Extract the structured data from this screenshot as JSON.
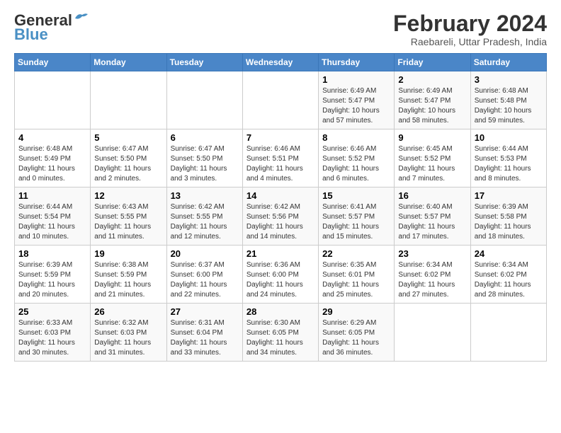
{
  "logo": {
    "line1": "General",
    "line2": "Blue"
  },
  "title": "February 2024",
  "subtitle": "Raebareli, Uttar Pradesh, India",
  "days_of_week": [
    "Sunday",
    "Monday",
    "Tuesday",
    "Wednesday",
    "Thursday",
    "Friday",
    "Saturday"
  ],
  "weeks": [
    [
      {
        "day": "",
        "info": ""
      },
      {
        "day": "",
        "info": ""
      },
      {
        "day": "",
        "info": ""
      },
      {
        "day": "",
        "info": ""
      },
      {
        "day": "1",
        "info": "Sunrise: 6:49 AM\nSunset: 5:47 PM\nDaylight: 10 hours and 57 minutes."
      },
      {
        "day": "2",
        "info": "Sunrise: 6:49 AM\nSunset: 5:47 PM\nDaylight: 10 hours and 58 minutes."
      },
      {
        "day": "3",
        "info": "Sunrise: 6:48 AM\nSunset: 5:48 PM\nDaylight: 10 hours and 59 minutes."
      }
    ],
    [
      {
        "day": "4",
        "info": "Sunrise: 6:48 AM\nSunset: 5:49 PM\nDaylight: 11 hours and 0 minutes."
      },
      {
        "day": "5",
        "info": "Sunrise: 6:47 AM\nSunset: 5:50 PM\nDaylight: 11 hours and 2 minutes."
      },
      {
        "day": "6",
        "info": "Sunrise: 6:47 AM\nSunset: 5:50 PM\nDaylight: 11 hours and 3 minutes."
      },
      {
        "day": "7",
        "info": "Sunrise: 6:46 AM\nSunset: 5:51 PM\nDaylight: 11 hours and 4 minutes."
      },
      {
        "day": "8",
        "info": "Sunrise: 6:46 AM\nSunset: 5:52 PM\nDaylight: 11 hours and 6 minutes."
      },
      {
        "day": "9",
        "info": "Sunrise: 6:45 AM\nSunset: 5:52 PM\nDaylight: 11 hours and 7 minutes."
      },
      {
        "day": "10",
        "info": "Sunrise: 6:44 AM\nSunset: 5:53 PM\nDaylight: 11 hours and 8 minutes."
      }
    ],
    [
      {
        "day": "11",
        "info": "Sunrise: 6:44 AM\nSunset: 5:54 PM\nDaylight: 11 hours and 10 minutes."
      },
      {
        "day": "12",
        "info": "Sunrise: 6:43 AM\nSunset: 5:55 PM\nDaylight: 11 hours and 11 minutes."
      },
      {
        "day": "13",
        "info": "Sunrise: 6:42 AM\nSunset: 5:55 PM\nDaylight: 11 hours and 12 minutes."
      },
      {
        "day": "14",
        "info": "Sunrise: 6:42 AM\nSunset: 5:56 PM\nDaylight: 11 hours and 14 minutes."
      },
      {
        "day": "15",
        "info": "Sunrise: 6:41 AM\nSunset: 5:57 PM\nDaylight: 11 hours and 15 minutes."
      },
      {
        "day": "16",
        "info": "Sunrise: 6:40 AM\nSunset: 5:57 PM\nDaylight: 11 hours and 17 minutes."
      },
      {
        "day": "17",
        "info": "Sunrise: 6:39 AM\nSunset: 5:58 PM\nDaylight: 11 hours and 18 minutes."
      }
    ],
    [
      {
        "day": "18",
        "info": "Sunrise: 6:39 AM\nSunset: 5:59 PM\nDaylight: 11 hours and 20 minutes."
      },
      {
        "day": "19",
        "info": "Sunrise: 6:38 AM\nSunset: 5:59 PM\nDaylight: 11 hours and 21 minutes."
      },
      {
        "day": "20",
        "info": "Sunrise: 6:37 AM\nSunset: 6:00 PM\nDaylight: 11 hours and 22 minutes."
      },
      {
        "day": "21",
        "info": "Sunrise: 6:36 AM\nSunset: 6:00 PM\nDaylight: 11 hours and 24 minutes."
      },
      {
        "day": "22",
        "info": "Sunrise: 6:35 AM\nSunset: 6:01 PM\nDaylight: 11 hours and 25 minutes."
      },
      {
        "day": "23",
        "info": "Sunrise: 6:34 AM\nSunset: 6:02 PM\nDaylight: 11 hours and 27 minutes."
      },
      {
        "day": "24",
        "info": "Sunrise: 6:34 AM\nSunset: 6:02 PM\nDaylight: 11 hours and 28 minutes."
      }
    ],
    [
      {
        "day": "25",
        "info": "Sunrise: 6:33 AM\nSunset: 6:03 PM\nDaylight: 11 hours and 30 minutes."
      },
      {
        "day": "26",
        "info": "Sunrise: 6:32 AM\nSunset: 6:03 PM\nDaylight: 11 hours and 31 minutes."
      },
      {
        "day": "27",
        "info": "Sunrise: 6:31 AM\nSunset: 6:04 PM\nDaylight: 11 hours and 33 minutes."
      },
      {
        "day": "28",
        "info": "Sunrise: 6:30 AM\nSunset: 6:05 PM\nDaylight: 11 hours and 34 minutes."
      },
      {
        "day": "29",
        "info": "Sunrise: 6:29 AM\nSunset: 6:05 PM\nDaylight: 11 hours and 36 minutes."
      },
      {
        "day": "",
        "info": ""
      },
      {
        "day": "",
        "info": ""
      }
    ]
  ]
}
